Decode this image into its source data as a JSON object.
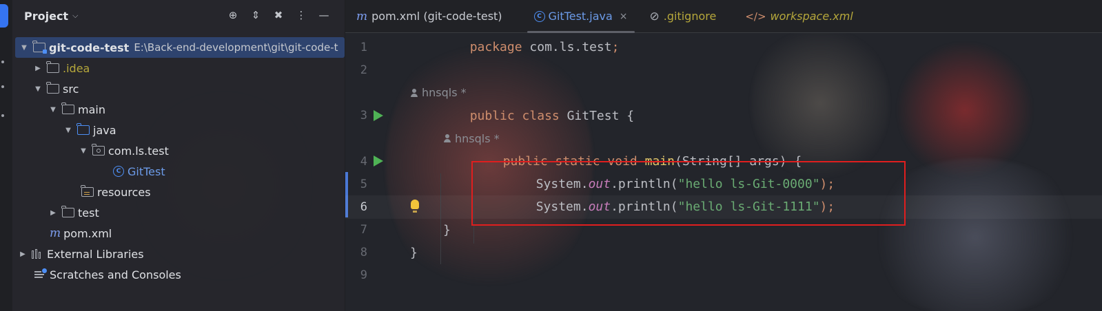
{
  "project_panel": {
    "title": "Project",
    "tree": [
      {
        "label": "git-code-test",
        "path": "E:\\Back-end-development\\git\\git-code-t"
      },
      {
        "label": ".idea"
      },
      {
        "label": "src"
      },
      {
        "label": "main"
      },
      {
        "label": "java"
      },
      {
        "label": "com.ls.test"
      },
      {
        "label": "GitTest"
      },
      {
        "label": "resources"
      },
      {
        "label": "test"
      },
      {
        "label": "pom.xml"
      },
      {
        "label": "External Libraries"
      },
      {
        "label": "Scratches and Consoles"
      }
    ]
  },
  "tabs": [
    {
      "label": "pom.xml (git-code-test)"
    },
    {
      "label": "GitTest.java",
      "close": "×"
    },
    {
      "label": ".gitignore"
    },
    {
      "label": "workspace.xml"
    }
  ],
  "code": {
    "line_numbers": [
      "1",
      "2",
      "3",
      "4",
      "5",
      "6",
      "7",
      "8",
      "9"
    ],
    "l1": {
      "kw": "package",
      "rest": " com.ls.test",
      "semi": ";"
    },
    "author1": "hnsqls *",
    "l3": {
      "kw": "public class",
      "rest": " GitTest {"
    },
    "author2": "hnsqls *",
    "l4": {
      "kw": "public static void",
      "fn": "main",
      "rest": "(String[] args) {"
    },
    "l5": {
      "p1": "System.",
      "field": "out",
      "p2": ".println(",
      "str": "\"hello ls-Git-0000\"",
      "end": ");"
    },
    "l6": {
      "p1": "System.",
      "field": "out",
      "p2": ".println(",
      "str": "\"hello ls-Git-1111\"",
      "end": ");"
    },
    "l7": "}",
    "l8": "}"
  }
}
